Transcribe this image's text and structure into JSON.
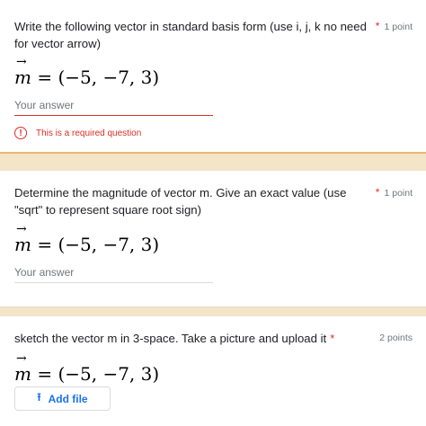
{
  "questions": [
    {
      "text": "Write the following vector in standard basis form (use i, j, k no need for vector arrow)",
      "required_star": "*",
      "points": "1 point",
      "math": {
        "var": "m",
        "rest": " = (−5, −7, 3)"
      },
      "answer_placeholder": "Your answer",
      "error": "This is a required question"
    },
    {
      "text": "Determine the magnitude of vector m.  Give an exact value (use \"sqrt\" to represent square root sign)",
      "required_star": "*",
      "points": "1 point",
      "math": {
        "var": "m",
        "rest": " = (−5, −7, 3)"
      },
      "answer_placeholder": "Your answer"
    },
    {
      "text": "sketch the vector m  in 3-space. Take a picture and upload it",
      "required_star": "*",
      "points": "2 points",
      "math": {
        "var": "m",
        "rest": " = (−5, −7, 3)"
      },
      "add_file_label": "Add file"
    }
  ],
  "colors": {
    "accent": "#1a73e8",
    "error": "#d93025",
    "background": "#f4e4c8"
  }
}
